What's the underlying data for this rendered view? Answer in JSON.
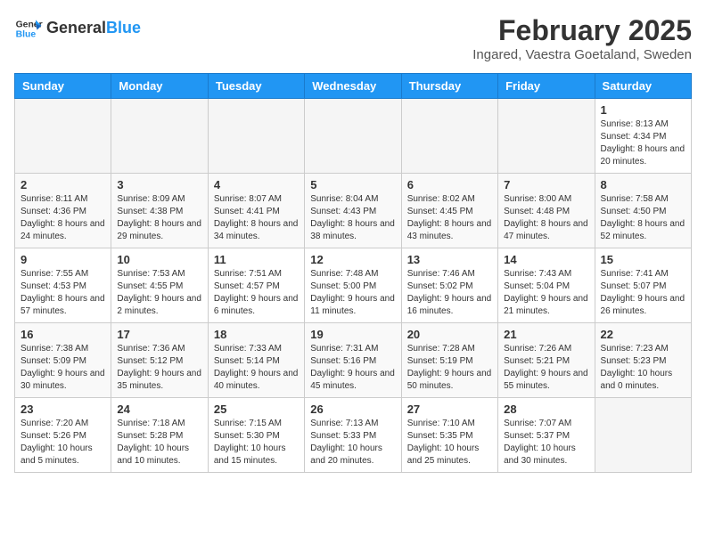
{
  "header": {
    "logo_general": "General",
    "logo_blue": "Blue",
    "title": "February 2025",
    "subtitle": "Ingared, Vaestra Goetaland, Sweden"
  },
  "calendar": {
    "days_of_week": [
      "Sunday",
      "Monday",
      "Tuesday",
      "Wednesday",
      "Thursday",
      "Friday",
      "Saturday"
    ],
    "weeks": [
      [
        {
          "day": "",
          "info": ""
        },
        {
          "day": "",
          "info": ""
        },
        {
          "day": "",
          "info": ""
        },
        {
          "day": "",
          "info": ""
        },
        {
          "day": "",
          "info": ""
        },
        {
          "day": "",
          "info": ""
        },
        {
          "day": "1",
          "info": "Sunrise: 8:13 AM\nSunset: 4:34 PM\nDaylight: 8 hours and 20 minutes."
        }
      ],
      [
        {
          "day": "2",
          "info": "Sunrise: 8:11 AM\nSunset: 4:36 PM\nDaylight: 8 hours and 24 minutes."
        },
        {
          "day": "3",
          "info": "Sunrise: 8:09 AM\nSunset: 4:38 PM\nDaylight: 8 hours and 29 minutes."
        },
        {
          "day": "4",
          "info": "Sunrise: 8:07 AM\nSunset: 4:41 PM\nDaylight: 8 hours and 34 minutes."
        },
        {
          "day": "5",
          "info": "Sunrise: 8:04 AM\nSunset: 4:43 PM\nDaylight: 8 hours and 38 minutes."
        },
        {
          "day": "6",
          "info": "Sunrise: 8:02 AM\nSunset: 4:45 PM\nDaylight: 8 hours and 43 minutes."
        },
        {
          "day": "7",
          "info": "Sunrise: 8:00 AM\nSunset: 4:48 PM\nDaylight: 8 hours and 47 minutes."
        },
        {
          "day": "8",
          "info": "Sunrise: 7:58 AM\nSunset: 4:50 PM\nDaylight: 8 hours and 52 minutes."
        }
      ],
      [
        {
          "day": "9",
          "info": "Sunrise: 7:55 AM\nSunset: 4:53 PM\nDaylight: 8 hours and 57 minutes."
        },
        {
          "day": "10",
          "info": "Sunrise: 7:53 AM\nSunset: 4:55 PM\nDaylight: 9 hours and 2 minutes."
        },
        {
          "day": "11",
          "info": "Sunrise: 7:51 AM\nSunset: 4:57 PM\nDaylight: 9 hours and 6 minutes."
        },
        {
          "day": "12",
          "info": "Sunrise: 7:48 AM\nSunset: 5:00 PM\nDaylight: 9 hours and 11 minutes."
        },
        {
          "day": "13",
          "info": "Sunrise: 7:46 AM\nSunset: 5:02 PM\nDaylight: 9 hours and 16 minutes."
        },
        {
          "day": "14",
          "info": "Sunrise: 7:43 AM\nSunset: 5:04 PM\nDaylight: 9 hours and 21 minutes."
        },
        {
          "day": "15",
          "info": "Sunrise: 7:41 AM\nSunset: 5:07 PM\nDaylight: 9 hours and 26 minutes."
        }
      ],
      [
        {
          "day": "16",
          "info": "Sunrise: 7:38 AM\nSunset: 5:09 PM\nDaylight: 9 hours and 30 minutes."
        },
        {
          "day": "17",
          "info": "Sunrise: 7:36 AM\nSunset: 5:12 PM\nDaylight: 9 hours and 35 minutes."
        },
        {
          "day": "18",
          "info": "Sunrise: 7:33 AM\nSunset: 5:14 PM\nDaylight: 9 hours and 40 minutes."
        },
        {
          "day": "19",
          "info": "Sunrise: 7:31 AM\nSunset: 5:16 PM\nDaylight: 9 hours and 45 minutes."
        },
        {
          "day": "20",
          "info": "Sunrise: 7:28 AM\nSunset: 5:19 PM\nDaylight: 9 hours and 50 minutes."
        },
        {
          "day": "21",
          "info": "Sunrise: 7:26 AM\nSunset: 5:21 PM\nDaylight: 9 hours and 55 minutes."
        },
        {
          "day": "22",
          "info": "Sunrise: 7:23 AM\nSunset: 5:23 PM\nDaylight: 10 hours and 0 minutes."
        }
      ],
      [
        {
          "day": "23",
          "info": "Sunrise: 7:20 AM\nSunset: 5:26 PM\nDaylight: 10 hours and 5 minutes."
        },
        {
          "day": "24",
          "info": "Sunrise: 7:18 AM\nSunset: 5:28 PM\nDaylight: 10 hours and 10 minutes."
        },
        {
          "day": "25",
          "info": "Sunrise: 7:15 AM\nSunset: 5:30 PM\nDaylight: 10 hours and 15 minutes."
        },
        {
          "day": "26",
          "info": "Sunrise: 7:13 AM\nSunset: 5:33 PM\nDaylight: 10 hours and 20 minutes."
        },
        {
          "day": "27",
          "info": "Sunrise: 7:10 AM\nSunset: 5:35 PM\nDaylight: 10 hours and 25 minutes."
        },
        {
          "day": "28",
          "info": "Sunrise: 7:07 AM\nSunset: 5:37 PM\nDaylight: 10 hours and 30 minutes."
        },
        {
          "day": "",
          "info": ""
        }
      ]
    ]
  }
}
